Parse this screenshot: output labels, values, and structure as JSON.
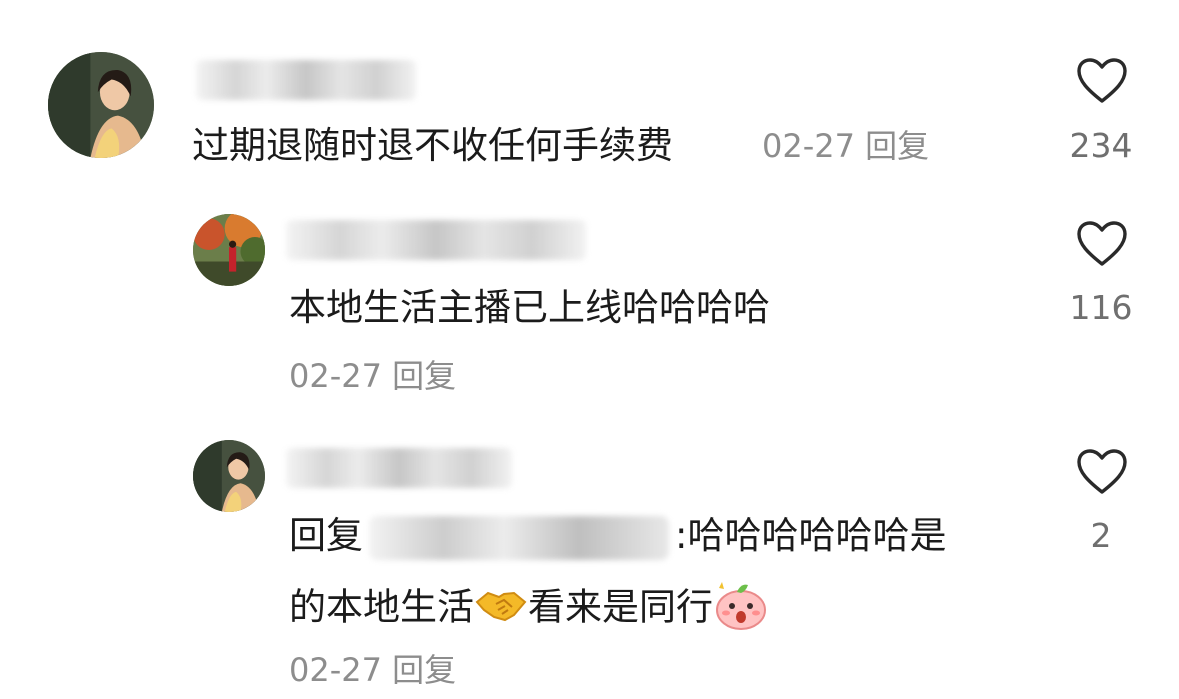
{
  "comments": [
    {
      "text": "过期退随时退不收任何手续费",
      "date": "02-27",
      "reply_label": "回复",
      "likes": "234",
      "avatar_icon": "woman-portrait-avatar"
    },
    {
      "text": "本地生活主播已上线哈哈哈哈",
      "date": "02-27",
      "reply_label": "回复",
      "likes": "116",
      "avatar_icon": "autumn-trees-avatar"
    },
    {
      "reply_prefix": "回复",
      "colon": ":",
      "text_part1": "哈哈哈哈哈哈是",
      "text_part2": "的本地生活",
      "text_part3": "看来是同行",
      "date": "02-27",
      "reply_label": "回复",
      "likes": "2",
      "avatar_icon": "woman-portrait-avatar",
      "emojis": [
        "handshake-emoji",
        "shocked-peach-emoji"
      ]
    }
  ],
  "colors": {
    "text": "#1b1b1b",
    "meta": "#8d8d8d",
    "count": "#6f6f6f"
  }
}
